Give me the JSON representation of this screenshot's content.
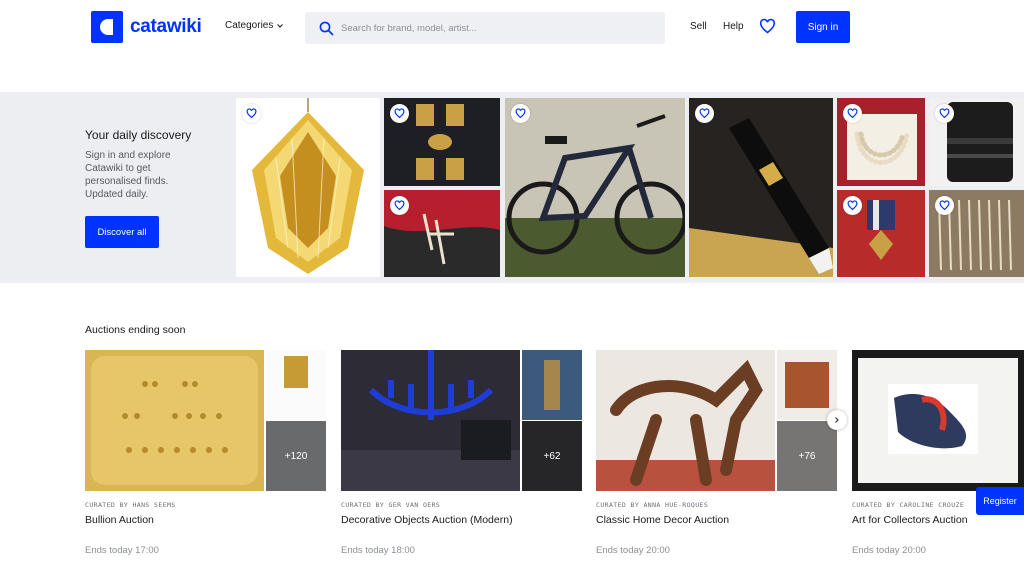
{
  "header": {
    "logo_text": "catawiki",
    "categories_label": "Categories",
    "search_placeholder": "Search for brand, model, artist...",
    "sell_label": "Sell",
    "help_label": "Help",
    "signin_label": "Sign in"
  },
  "discovery": {
    "title": "Your daily discovery",
    "body": "Sign in and explore Catawiki to get personalised finds. Updated daily.",
    "button_label": "Discover all"
  },
  "auctions": {
    "section_title": "Auctions ending soon",
    "cards": [
      {
        "curator": "CURATED BY HANS SEEMS",
        "name": "Bullion Auction",
        "more": "+120",
        "ends": "Ends today 17:00"
      },
      {
        "curator": "CURATED BY GER VAN OERS",
        "name": "Decorative Objects Auction (Modern)",
        "more": "+62",
        "ends": "Ends today 18:00"
      },
      {
        "curator": "CURATED BY ANNA HUE-ROQUES",
        "name": "Classic Home Decor Auction",
        "more": "+76",
        "ends": "Ends today 20:00"
      },
      {
        "curator": "CURATED BY CAROLINE CROUZE",
        "name": "Art for Collectors Auction",
        "more": "",
        "ends": "Ends today 20:00"
      }
    ]
  },
  "register_label": "Register",
  "colors": {
    "accent": "#0033ff",
    "band": "#edeef1"
  },
  "icons": [
    "search-icon",
    "heart-icon",
    "chevron-down-icon",
    "chevron-right-icon"
  ]
}
